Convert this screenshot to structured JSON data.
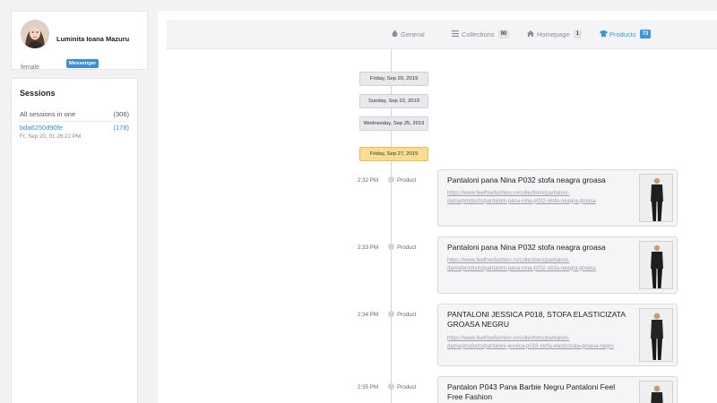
{
  "profile": {
    "name": "Luminita Ioana Mazuru",
    "platform": "Messenger",
    "gender": "female",
    "avatar_icon": "person-avatar-icon"
  },
  "sessions": {
    "title": "Sessions",
    "all": {
      "label": "All sessions in one",
      "count": "(306)"
    },
    "items": [
      {
        "id": "bda6250d90fe",
        "count": "(178)",
        "time": "Fr, Sep 20, 01:26:22 PM"
      }
    ]
  },
  "tabs": [
    {
      "label": "General",
      "icon": "droplet-icon",
      "count": ""
    },
    {
      "label": "Collections",
      "icon": "list-icon",
      "count": "90"
    },
    {
      "label": "Homepage",
      "icon": "home-icon",
      "count": "1"
    },
    {
      "label": "Products",
      "icon": "shirt-icon",
      "count": "73",
      "active": true
    }
  ],
  "dates": [
    {
      "label": "Friday, Sep 20, 2019"
    },
    {
      "label": "Sunday, Sep 22, 2019"
    },
    {
      "label": "Wednesday, Sep 25, 2019"
    },
    {
      "label": "Friday, Sep 27, 2019",
      "active": true
    }
  ],
  "events": [
    {
      "time": "2:32 PM",
      "type": "Product",
      "title": "Pantaloni pana Nina P032 stofa neagra groasa",
      "url": "https://www.feelfreefashion.ro/collections/pantaloni-dama/products/pantaloni-pana-nina-p032-stofa-neagra-groasa"
    },
    {
      "time": "2:33 PM",
      "type": "Product",
      "title": "Pantaloni pana Nina P032 stofa neagra groasa",
      "url": "https://www.feelfreefashion.ro/collections/pantaloni-dama/products/pantaloni-pana-nina-p032-stofa-neagra-groasa"
    },
    {
      "time": "2:34 PM",
      "type": "Product",
      "title": "PANTALONI JESSICA P018, STOFA ELASTICIZATA GROASA NEGRU",
      "url": "https://www.feelfreefashion.ro/collections/pantaloni-dama/products/pantaloni-jessica-p018-stofa-elasticizata-groasa-negru"
    },
    {
      "time": "2:35 PM",
      "type": "Product",
      "title": "Pantalon P043 Pana Barbie Negru Pantaloni Feel Free Fashion",
      "url": ""
    }
  ],
  "colors": {
    "accent": "#3a95dd",
    "badge": "#3d8fd1",
    "active_date": "#f8dc92"
  }
}
